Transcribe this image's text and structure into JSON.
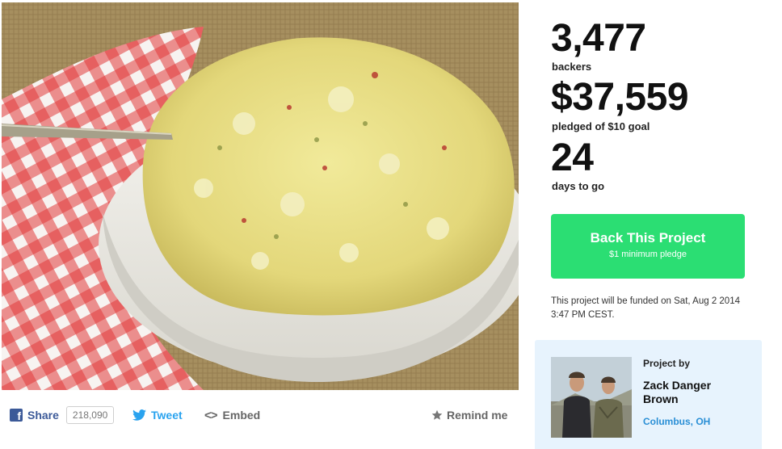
{
  "share": {
    "facebook_label": "Share",
    "facebook_count": "218,090",
    "tweet_label": "Tweet",
    "embed_label": "Embed",
    "remind_label": "Remind me"
  },
  "stats": {
    "backers_count": "3,477",
    "backers_label": "backers",
    "pledged_amount": "$37,559",
    "pledged_label": "pledged of $10 goal",
    "days_count": "24",
    "days_label": "days to go"
  },
  "back_button": {
    "label": "Back This Project",
    "sublabel": "$1 minimum pledge"
  },
  "funding_note": "This project will be funded on Sat, Aug 2 2014 3:47 PM CEST.",
  "creator": {
    "heading": "Project by",
    "name": "Zack Danger Brown",
    "location": "Columbus, OH"
  },
  "colors": {
    "back_button": "#2bde73",
    "facebook": "#3b5998",
    "twitter": "#2aa3ef",
    "creator_card_bg": "#e7f3fd",
    "location_link": "#2a8fd6"
  },
  "icons": {
    "facebook": "facebook-icon",
    "twitter": "twitter-bird-icon",
    "embed": "code-brackets-icon",
    "remind": "star-icon"
  }
}
